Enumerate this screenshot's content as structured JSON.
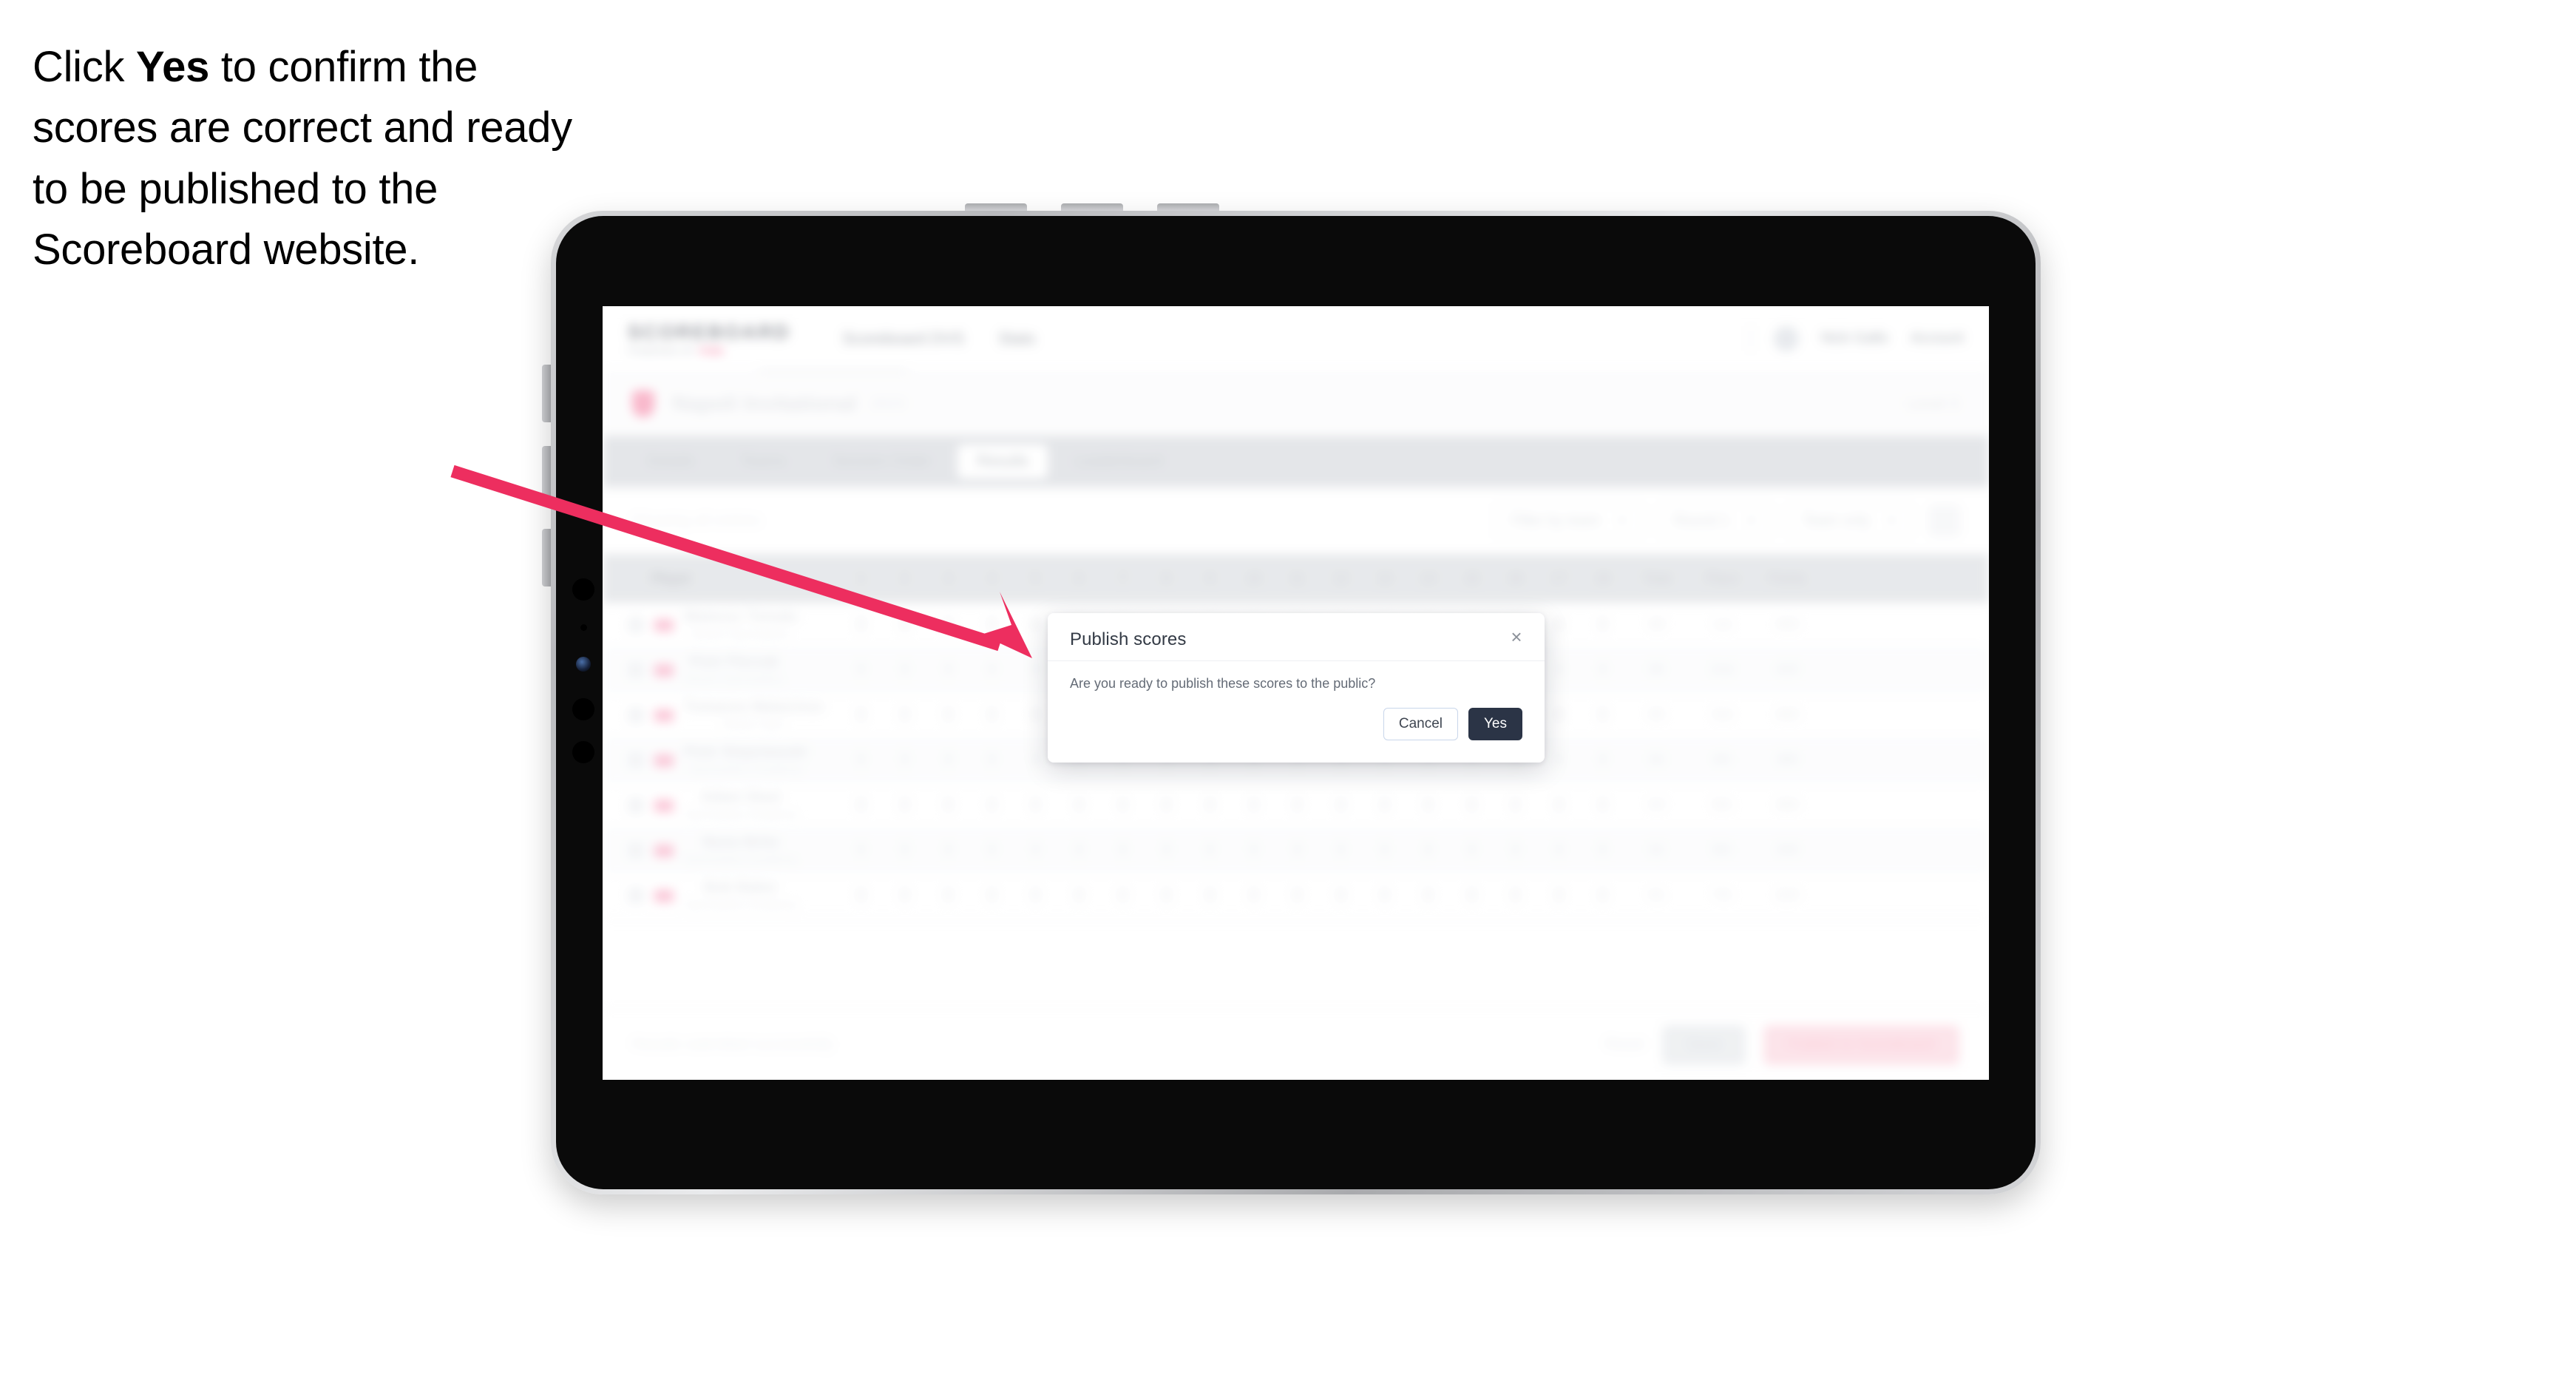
{
  "caption": {
    "prefix": "Click ",
    "bold": "Yes",
    "suffix": " to confirm the scores are correct and ready to be published to the Scoreboard website."
  },
  "colors": {
    "arrow": "#ED2E5F",
    "brand_accent": "#F0316B",
    "primary_button": "#2B3446",
    "cancel_border": "#C9D6EA"
  },
  "dialog": {
    "title": "Publish scores",
    "close_label": "×",
    "message": "Are you ready to publish these scores to the public?",
    "cancel_label": "Cancel",
    "confirm_label": "Yes"
  },
  "app": {
    "brand": {
      "name": "SCOREBOARD",
      "sub_left": "POWERED BY",
      "sub_accent": "PINK"
    },
    "nav_links": [
      "Scoreboard DVS",
      "Stats"
    ],
    "nav_user": {
      "name": "Nick Gallo",
      "menu": "Account"
    },
    "event": {
      "title": "Napoli Invitational",
      "sub": "2023",
      "right": "Level 3"
    },
    "tabs": [
      {
        "label": "Details",
        "active": false
      },
      {
        "label": "Teams",
        "active": false
      },
      {
        "label": "Session Order",
        "active": false
      },
      {
        "label": "Results",
        "active": true
      },
      {
        "label": "Leaderboard",
        "active": false
      }
    ],
    "toolbar": {
      "left_note": "Showing all entries",
      "filters": [
        {
          "label": "Filter by team"
        },
        {
          "label": "Round 1"
        },
        {
          "label": "Team only"
        }
      ]
    },
    "table": {
      "player_header": "Player",
      "num_headers": [
        "1",
        "2",
        "3",
        "4",
        "5",
        "6",
        "7",
        "8",
        "9",
        "10",
        "11",
        "12",
        "13",
        "14",
        "15",
        "16",
        "17",
        "18"
      ],
      "wide_headers": [
        "Total",
        "Place",
        "Points"
      ],
      "rows": [
        {
          "name": "Mateusz Tomala",
          "club": "Desert Gymnastics",
          "scores": [
            "9",
            "9",
            "9",
            "9",
            "9",
            "9",
            "9",
            "9",
            "9",
            "9",
            "9",
            "9",
            "9",
            "9",
            "9",
            "9",
            "9",
            "9"
          ],
          "total": "88",
          "place": "1st",
          "points": "450",
          "alt": false
        },
        {
          "name": "Piotr Pierzak",
          "club": "Desert Gymnastics",
          "scores": [
            "9",
            "9",
            "9",
            "9",
            "9",
            "9",
            "9",
            "9",
            "9",
            "9",
            "9",
            "9",
            "9",
            "9",
            "9",
            "9",
            "9",
            "9"
          ],
          "total": "86",
          "place": "2nd",
          "points": "420",
          "alt": true
        },
        {
          "name": "Tomasso Malacinso",
          "club": "Desert Gym",
          "scores": [
            "9",
            "9",
            "9",
            "9",
            "9",
            "9",
            "9",
            "9",
            "9",
            "9",
            "9",
            "9",
            "9",
            "9",
            "9",
            "9",
            "9",
            "9"
          ],
          "total": "85",
          "place": "3rd",
          "points": "400",
          "alt": false
        },
        {
          "name": "Piotr Stepniewski",
          "club": "Gymnastics Academy",
          "scores": [
            "9",
            "9",
            "9",
            "9",
            "9",
            "9",
            "9",
            "9",
            "9",
            "9",
            "9",
            "9",
            "9",
            "9",
            "9",
            "9",
            "9",
            "9"
          ],
          "total": "84",
          "place": "4th",
          "points": "380",
          "alt": true
        },
        {
          "name": "Adam Stasi",
          "club": "Gymnastics Academy",
          "scores": [
            "9",
            "9",
            "9",
            "9",
            "9",
            "9",
            "9",
            "9",
            "9",
            "9",
            "9",
            "9",
            "9",
            "9",
            "9",
            "9",
            "9",
            "9"
          ],
          "total": "83",
          "place": "5th",
          "points": "360",
          "alt": false
        },
        {
          "name": "Nuno Brito",
          "club": "Gymnastics Academy",
          "scores": [
            "9",
            "9",
            "9",
            "9",
            "9",
            "9",
            "9",
            "9",
            "9",
            "9",
            "9",
            "9",
            "9",
            "9",
            "9",
            "9",
            "9",
            "9"
          ],
          "total": "82",
          "place": "6th",
          "points": "340",
          "alt": true
        },
        {
          "name": "Bob Baker",
          "club": "Gymnastics Academy",
          "scores": [
            "9",
            "9",
            "9",
            "9",
            "9",
            "9",
            "9",
            "9",
            "9",
            "9",
            "9",
            "9",
            "9",
            "9",
            "9",
            "9",
            "9",
            "9"
          ],
          "total": "81",
          "place": "7th",
          "points": "320",
          "alt": false
        }
      ]
    },
    "footer": {
      "note": "Results submitted successfully",
      "link": "Reset",
      "secondary_button": "Save",
      "primary_button": "Publish to Scoreboard"
    }
  }
}
